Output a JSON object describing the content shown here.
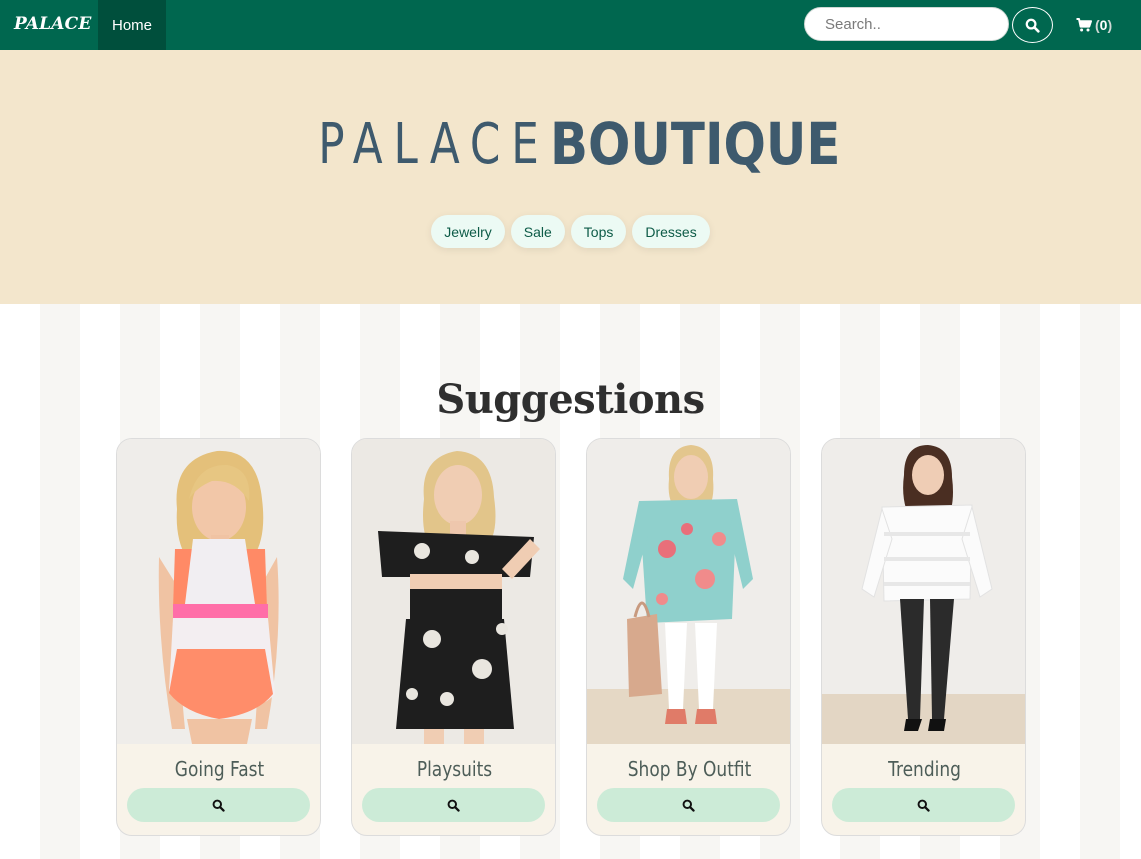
{
  "navbar": {
    "brand": "PALACE",
    "home_label": "Home",
    "search_placeholder": "Search..",
    "cart_count": "0",
    "cart_open": "(",
    "cart_close": ")"
  },
  "hero": {
    "title_thin": "PALACE",
    "title_bold": "BOUTIQUE",
    "categories": [
      {
        "label": "Jewelry"
      },
      {
        "label": "Sale"
      },
      {
        "label": "Tops"
      },
      {
        "label": "Dresses"
      }
    ]
  },
  "suggestions": {
    "title": "Suggestions",
    "cards": [
      {
        "label": "Going Fast",
        "icon": "search-icon"
      },
      {
        "label": "Playsuits",
        "icon": "search-icon"
      },
      {
        "label": "Shop By Outfit",
        "icon": "search-icon"
      },
      {
        "label": "Trending",
        "icon": "search-icon"
      }
    ]
  },
  "colors": {
    "navbar": "#00674f",
    "home_active": "#004f3c",
    "hero_bg": "#f3e6cc",
    "hero_title": "#3e5a6d",
    "pill_bg": "#ecfaf4",
    "card_btn": "#ccebd7"
  }
}
